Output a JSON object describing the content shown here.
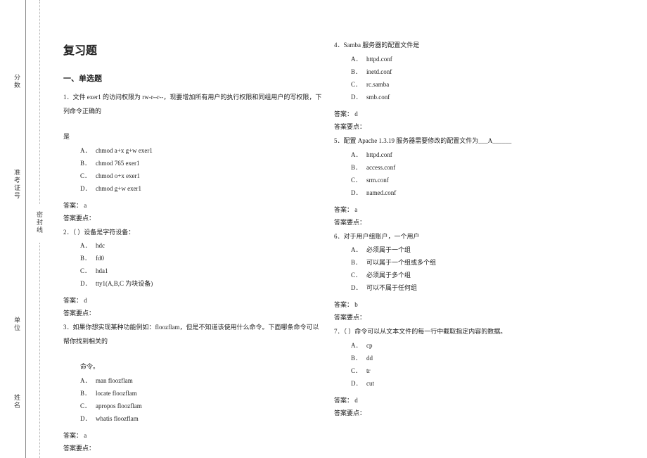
{
  "margin_labels": {
    "fenshu": "分数",
    "zhunkao": "准考证号",
    "mifengxian": "密封线",
    "danwei": "单位",
    "xingming": "姓名"
  },
  "doc_title": "复习题",
  "section1_title": "一、单选题",
  "ans_prefix": "答案：",
  "exp_prefix": "答案要点：",
  "opt_labels": {
    "A": "A．",
    "B": "B．",
    "C": "C．",
    "D": "D．"
  },
  "q1": {
    "num": "1．",
    "stem": "文件 exer1 的访问权限为 rw-r--r--，现要增加所有用户的执行权限和同组用户的写权限，下列命令正确的",
    "cont": "是",
    "optA": "chmod a+x g+w exer1",
    "optB": "chmod 765 exer1",
    "optC": "chmod o+x exer1",
    "optD": "chmod g+w exer1",
    "ans": "a"
  },
  "q2": {
    "num": "2．",
    "stem": "（  ）设备是字符设备：",
    "optA": "hdc",
    "optB": "fd0",
    "optC": "hda1",
    "optD": "tty1(A,B,C 为块设备)",
    "ans": "d"
  },
  "q3": {
    "num": "3．",
    "stem": "如果你想实现某种功能例如：floozflam，但是不知道该使用什么命令。下面哪条命令可以帮你找到相关的",
    "cont": "命令。",
    "optA": "man     floozflam",
    "optB": "locate     floozflam",
    "optC": "apropos     floozflam",
    "optD": "whatis     floozflam",
    "ans": "a"
  },
  "q4": {
    "num": "4．",
    "stem": "Samba 服务器的配置文件是",
    "optA": "httpd.conf",
    "optB": "inetd.conf",
    "optC": "rc.samba",
    "optD": "smb.conf",
    "ans": "d"
  },
  "q5": {
    "num": "5．",
    "stem": "配置 Apache 1.3.19 服务器需要修改的配置文件为___A______",
    "optA": "httpd.conf",
    "optB": "access.conf",
    "optC": "srm.conf",
    "optD": "named.conf",
    "ans": "a"
  },
  "q6": {
    "num": "6．",
    "stem": "对于用户组账户，一个用户",
    "optA": "必须属于一个组",
    "optB": "可以属于一个组或多个组",
    "optC": "必须属于多个组",
    "optD": "可以不属于任何组",
    "ans": "b"
  },
  "q7": {
    "num": "7．",
    "stem": "（     ）命令可以从文本文件的每一行中截取指定内容的数据。",
    "optA": "cp",
    "optB": "dd",
    "optC": "tr",
    "optD": "cut",
    "ans": "d"
  }
}
